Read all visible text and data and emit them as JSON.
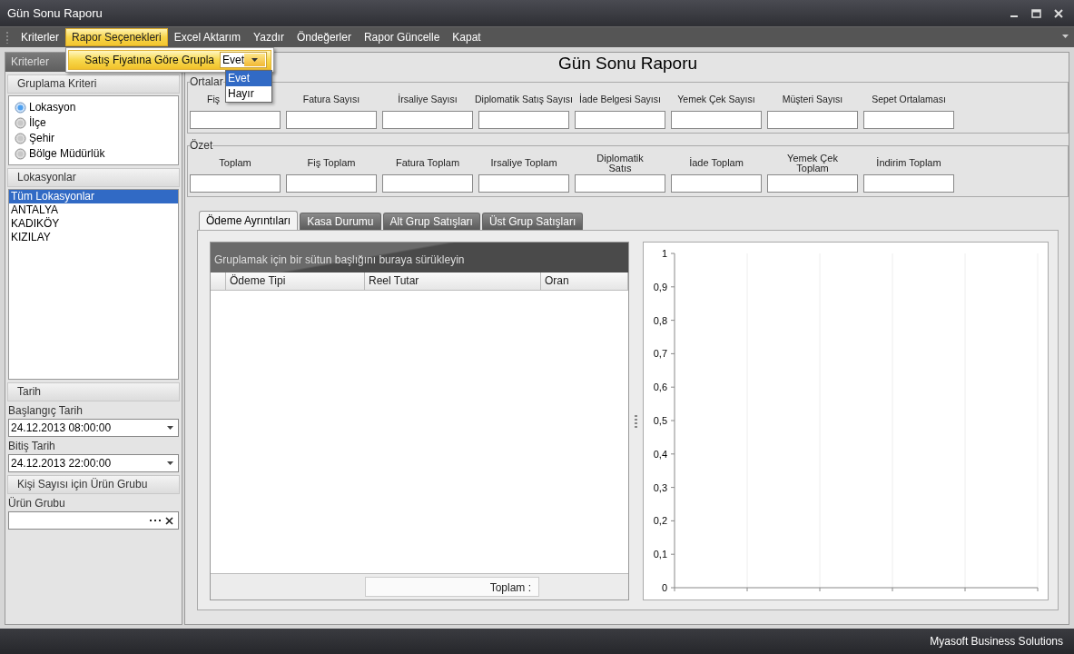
{
  "window": {
    "title": "Gün Sonu Raporu"
  },
  "menu": {
    "items": [
      {
        "label": "Kriterler",
        "selected": false
      },
      {
        "label": "Rapor Seçenekleri",
        "selected": true
      },
      {
        "label": "Excel Aktarım",
        "selected": false
      },
      {
        "label": "Yazdır",
        "selected": false
      },
      {
        "label": "Öndeğerler",
        "selected": false
      },
      {
        "label": "Rapor Güncelle",
        "selected": false
      },
      {
        "label": "Kapat",
        "selected": false
      }
    ]
  },
  "options_menu": {
    "label": "Satış Fiyatına Göre Grupla",
    "value": "Evet",
    "options": [
      {
        "label": "Evet",
        "selected": true
      },
      {
        "label": "Hayır",
        "selected": false
      }
    ]
  },
  "sidebar": {
    "title": "Kriterler",
    "grouping": {
      "title": "Gruplama Kriteri",
      "options": [
        {
          "label": "Lokasyon",
          "selected": true
        },
        {
          "label": "İlçe",
          "selected": false
        },
        {
          "label": "Şehir",
          "selected": false
        },
        {
          "label": "Bölge Müdürlük",
          "selected": false
        }
      ]
    },
    "locations": {
      "title": "Lokasyonlar",
      "items": [
        {
          "label": "Tüm Lokasyonlar",
          "selected": true
        },
        {
          "label": "ANTALYA",
          "selected": false
        },
        {
          "label": "KADIKÖY",
          "selected": false
        },
        {
          "label": "KIZILAY",
          "selected": false
        }
      ]
    },
    "date": {
      "title": "Tarih",
      "fields": [
        {
          "label": "Başlangıç Tarih",
          "value": "24.12.2013 08:00:00"
        },
        {
          "label": "Bitiş Tarih",
          "value": "24.12.2013 22:00:00"
        }
      ]
    },
    "product_group": {
      "title": "Kişi Sayısı için Ürün Grubu",
      "field_label": "Ürün Grubu"
    }
  },
  "report": {
    "title": "Gün Sonu Raporu",
    "sections": [
      {
        "legend": "Ortalar",
        "fields": [
          "Fiş",
          "Fatura Sayısı",
          "İrsaliye Sayısı",
          "Diplomatik Satış Sayısı",
          "İade Belgesi Sayısı",
          "Yemek Çek Sayısı",
          "Müşteri Sayısı",
          "Sepet Ortalaması"
        ]
      },
      {
        "legend": "Özet",
        "fields": [
          "Toplam",
          "Fiş Toplam",
          "Fatura Toplam",
          "Irsaliye Toplam",
          "Diplomatik Satıs",
          "İade Toplam",
          "Yemek Çek Toplam",
          "İndirim Toplam"
        ]
      }
    ]
  },
  "tabs": [
    {
      "label": "Ödeme Ayrıntıları",
      "selected": true
    },
    {
      "label": "Kasa Durumu",
      "selected": false
    },
    {
      "label": "Alt Grup Satışları",
      "selected": false
    },
    {
      "label": "Üst Grup Satışları",
      "selected": false
    }
  ],
  "grid": {
    "group_panel": "Gruplamak için bir sütun başlığını buraya sürükleyin",
    "columns": [
      "Ödeme Tipi",
      "Reel Tutar",
      "Oran"
    ],
    "footer": "Toplam :"
  },
  "chart": {
    "y_labels": [
      "1",
      "0,9",
      "0,8",
      "0,7",
      "0,6",
      "0,5",
      "0,4",
      "0,3",
      "0,2",
      "0,1",
      "0"
    ]
  },
  "status_bar": {
    "text": "Myasoft Business Solutions"
  }
}
